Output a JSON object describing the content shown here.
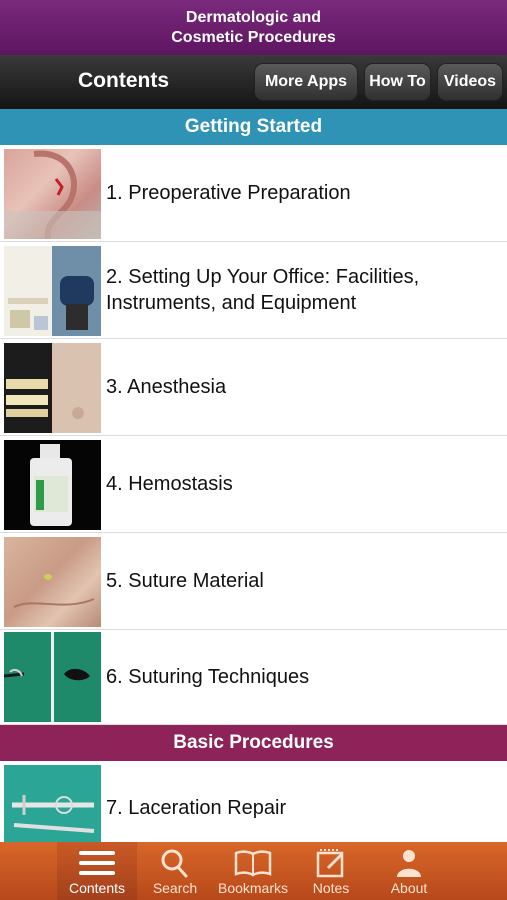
{
  "app_header": {
    "line1": "Dermatologic and",
    "line2": "Cosmetic Procedures"
  },
  "navbar": {
    "title": "Contents",
    "buttons": [
      "More Apps",
      "How To",
      "Videos"
    ]
  },
  "sections": {
    "getting_started": "Getting Started",
    "basic_procedures": "Basic Procedures"
  },
  "items": [
    {
      "line1": "1. Preoperative Preparation",
      "line2": ""
    },
    {
      "line1": "2. Setting Up Your Office: Facilities,",
      "line2": "Instruments, and Equipment"
    },
    {
      "line1": "3. Anesthesia",
      "line2": ""
    },
    {
      "line1": "4. Hemostasis",
      "line2": ""
    },
    {
      "line1": "5. Suture Material",
      "line2": ""
    },
    {
      "line1": "6. Suturing Techniques",
      "line2": ""
    },
    {
      "line1": "7. Laceration Repair",
      "line2": ""
    }
  ],
  "tabbar": {
    "tabs": [
      {
        "label": "Contents",
        "icon": "list-icon",
        "active": true
      },
      {
        "label": "Search",
        "icon": "search-icon",
        "active": false
      },
      {
        "label": "Bookmarks",
        "icon": "book-icon",
        "active": false
      },
      {
        "label": "Notes",
        "icon": "notepad-icon",
        "active": false
      },
      {
        "label": "About",
        "icon": "person-icon",
        "active": false
      }
    ]
  },
  "colors": {
    "header": "#6b1f6e",
    "section_getting_started": "#2f93b5",
    "section_basic_procedures": "#8d2358",
    "tabbar": "#c9581f"
  }
}
